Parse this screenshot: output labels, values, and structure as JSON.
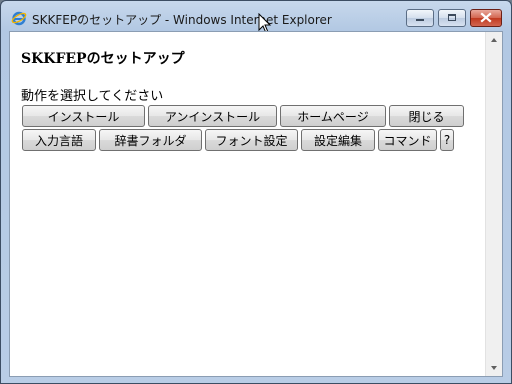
{
  "window": {
    "title": "SKKFEPのセットアップ - Windows Internet Explorer"
  },
  "page": {
    "heading": "SKKFEPのセットアップ",
    "prompt": "動作を選択してください"
  },
  "buttons_row1": [
    {
      "label": "インストール"
    },
    {
      "label": "アンインストール"
    },
    {
      "label": "ホームページ"
    },
    {
      "label": "閉じる"
    }
  ],
  "buttons_row2": [
    {
      "label": "入力言語"
    },
    {
      "label": "辞書フォルダ"
    },
    {
      "label": "フォント設定"
    },
    {
      "label": "設定編集"
    },
    {
      "label": "コマンド"
    },
    {
      "label": "?"
    }
  ],
  "colors": {
    "titlebar": "#b9cde6",
    "close_button": "#c0391f",
    "content_background": "#ffffff"
  },
  "icons": [
    "internet-explorer-icon",
    "minimize-icon",
    "maximize-icon",
    "close-icon",
    "mouse-cursor-icon",
    "scroll-up-icon",
    "scroll-down-icon"
  ]
}
